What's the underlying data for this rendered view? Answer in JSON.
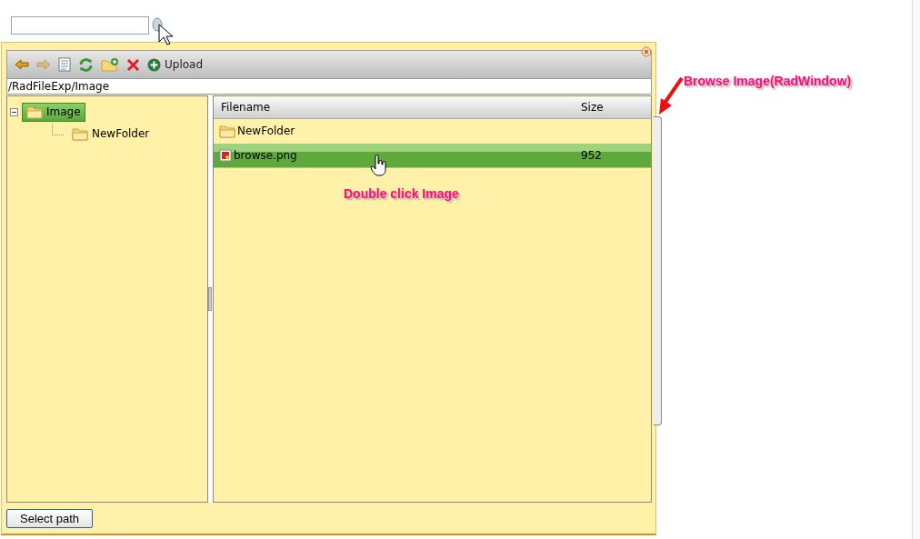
{
  "toolbar": {
    "buttons": [
      {
        "kind": "back",
        "disabled": false
      },
      {
        "kind": "forward",
        "disabled": true
      },
      {
        "kind": "view"
      },
      {
        "kind": "refresh"
      },
      {
        "kind": "new-folder"
      },
      {
        "kind": "delete"
      },
      {
        "kind": "upload",
        "label": "Upload"
      }
    ]
  },
  "path": {
    "value": "/RadFileExp/Image"
  },
  "tree": {
    "items": [
      {
        "label": "Image",
        "selected": true,
        "expanded": true,
        "children": [
          {
            "label": "NewFolder",
            "selected": false
          }
        ]
      }
    ]
  },
  "grid": {
    "columns": [
      "Filename",
      "Size"
    ],
    "rows": [
      {
        "kind": "folder",
        "name": "NewFolder",
        "size": "",
        "selected": false
      },
      {
        "kind": "image",
        "name": "browse.png",
        "size": "952",
        "selected": true
      }
    ]
  },
  "footer": {
    "button": "Select path"
  },
  "annotations": [
    {
      "kind": "window",
      "text": "Browse Image(RadWindow)"
    },
    {
      "kind": "hint",
      "text": "Double click Image"
    }
  ]
}
